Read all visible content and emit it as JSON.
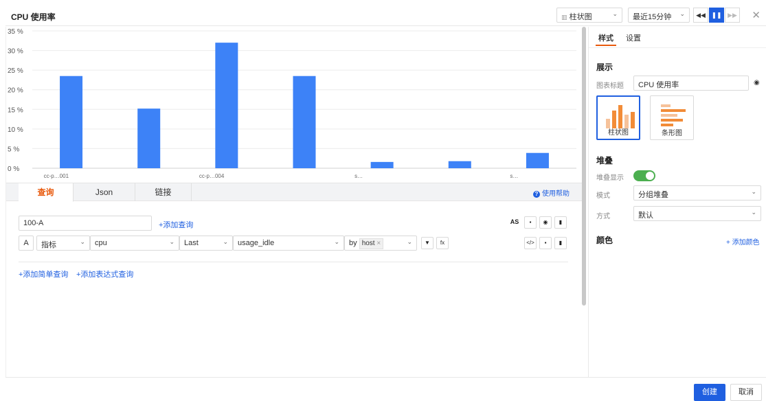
{
  "header": {
    "title": "CPU 使用率",
    "chart_type_value": "柱状图",
    "time_range_value": "最近15分钟",
    "rewind_icon": "rewind-icon",
    "pause_icon": "pause-icon",
    "forward_icon": "fast-forward-icon",
    "close_icon": "close-icon"
  },
  "chart_data": {
    "type": "bar",
    "categories": [
      "cc-p…001",
      "",
      "cc-p…004",
      "",
      "s…",
      "",
      "s…"
    ],
    "values": [
      23.5,
      15.2,
      32,
      23.5,
      1.6,
      1.8,
      3.9
    ],
    "ylim": [
      0,
      35
    ],
    "yticks": [
      "0 %",
      "5 %",
      "10 %",
      "15 %",
      "20 %",
      "25 %",
      "30 %",
      "35 %"
    ],
    "yticks_values": [
      0,
      5,
      10,
      15,
      20,
      25,
      30,
      35
    ],
    "title": "",
    "xlabel": "",
    "ylabel": "",
    "grid": true,
    "color": "#3d82f7"
  },
  "tabs": {
    "query": "查询",
    "json": "Json",
    "link": "链接",
    "help": "使用帮助"
  },
  "query": {
    "expression_value": "100-A",
    "add_query": "+添加查询",
    "as_label": "AS",
    "row_label": "A",
    "metric_type": "指标",
    "measurement": "cpu",
    "aggregation": "Last",
    "field": "usage_idle",
    "by_label": "by",
    "group_tag": "host",
    "fx_label": "fx",
    "add_simple_query": "+添加简单查询",
    "add_expression_query": "+添加表达式查询"
  },
  "style_panel": {
    "tab_style": "样式",
    "tab_settings": "设置",
    "display_heading": "展示",
    "chart_title_label": "图表标题",
    "chart_title_value": "CPU 使用率",
    "card_bar": "柱状图",
    "card_hbar": "条形图",
    "stack_heading": "堆叠",
    "stack_display_label": "堆叠显示",
    "stack_display_on": true,
    "mode_label": "模式",
    "mode_value": "分组堆叠",
    "method_label": "方式",
    "method_value": "默认",
    "color_heading": "颜色",
    "add_color": "+ 添加颜色"
  },
  "footer": {
    "create": "创建",
    "cancel": "取消"
  },
  "colors": {
    "accent": "#1f5fe0",
    "active_tab": "#e8590c",
    "bar": "#3d82f7",
    "chart_card_orange": "#f28c38",
    "toggle_on": "#4caf50"
  }
}
